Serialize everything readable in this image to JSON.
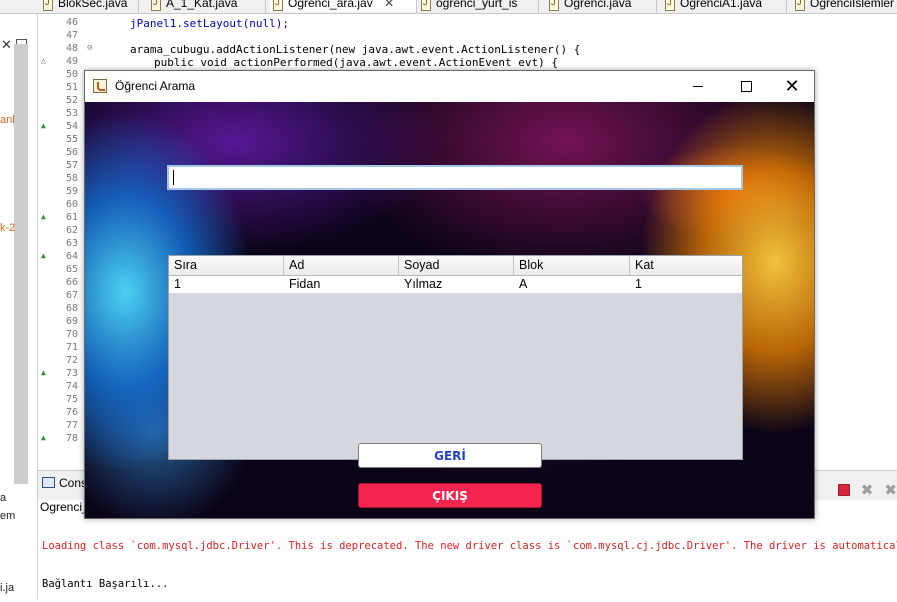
{
  "ide": {
    "tabs": [
      {
        "label": "BlokSec.java"
      },
      {
        "label": "A_1_Kat.java"
      },
      {
        "label": "Ogrenci_ara.jav",
        "active": true,
        "close": "✕"
      },
      {
        "label": "ogrenci_yurt_is"
      },
      {
        "label": "Ogrenci.java"
      },
      {
        "label": "OgrenciA1.java"
      },
      {
        "label": "OgrenciIslemler"
      }
    ],
    "left_fragments": [
      "anl",
      "k-2",
      "a",
      "em",
      "i.ja"
    ],
    "gutter": [
      "46",
      "47",
      "48",
      "49",
      "50",
      "51",
      "52",
      "53",
      "54",
      "55",
      "56",
      "57",
      "58",
      "59",
      "60",
      "61",
      "62",
      "63",
      "64",
      "65",
      "66",
      "67",
      "68",
      "69",
      "70",
      "71",
      "72",
      "73",
      "74",
      "75",
      "76",
      "77",
      "78"
    ],
    "code": {
      "line46": "jPanel1.setLayout(null);",
      "line48": "arama_cubugu.addActionListener(new java.awt.event.ActionListener() {",
      "line49": "public void actionPerformed(java.awt.event.ActionEvent evt) {"
    },
    "console": {
      "tab_label": "Cons",
      "sub_label": "Ogrenci_",
      "error_line": "Loading class `com.mysql.jdbc.Driver'. This is deprecated. The new driver class is `com.mysql.cj.jdbc.Driver'. The driver is automatically regi",
      "output_line": "Bağlantı Başarılı..."
    }
  },
  "dialog": {
    "title": "Öğrenci Arama",
    "search": {
      "value": ""
    },
    "table": {
      "columns": [
        "Sıra",
        "Ad",
        "Soyad",
        "Blok",
        "Kat"
      ],
      "rows": [
        [
          "1",
          "Fidan",
          "Yılmaz",
          "A",
          "1"
        ]
      ]
    },
    "buttons": {
      "back_label": "GERİ",
      "exit_label": "ÇIKIŞ"
    }
  },
  "colors": {
    "back_text": "#1f3fd6",
    "exit_bg": "#f5244f",
    "table_empty_bg": "#d4d7de"
  }
}
